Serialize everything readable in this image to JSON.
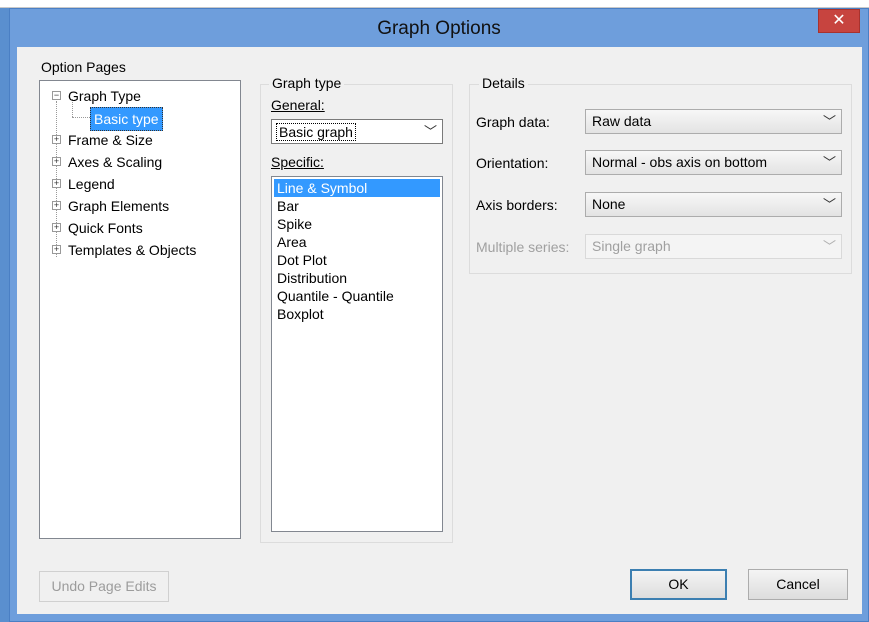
{
  "window": {
    "title": "Graph Options",
    "close_glyph": "✕"
  },
  "option_pages": {
    "label": "Option Pages",
    "items": [
      {
        "label": "Graph Type",
        "expander": "−"
      },
      {
        "label": "Basic type"
      },
      {
        "label": "Frame & Size",
        "expander": "+"
      },
      {
        "label": "Axes & Scaling",
        "expander": "+"
      },
      {
        "label": "Legend",
        "expander": "+"
      },
      {
        "label": "Graph Elements",
        "expander": "+"
      },
      {
        "label": "Quick Fonts",
        "expander": "+"
      },
      {
        "label": "Templates & Objects",
        "expander": "+"
      }
    ]
  },
  "graph_type": {
    "group_label": "Graph type",
    "general_label": "General:",
    "general_value": "Basic graph",
    "specific_label": "Specific:",
    "specific_items": [
      "Line & Symbol",
      "Bar",
      "Spike",
      "Area",
      "Dot Plot",
      "Distribution",
      "Quantile - Quantile",
      "Boxplot"
    ]
  },
  "details": {
    "group_label": "Details",
    "graph_data_label": "Graph data:",
    "graph_data_value": "Raw data",
    "orientation_label": "Orientation:",
    "orientation_value": "Normal - obs axis on bottom",
    "axis_borders_label": "Axis borders:",
    "axis_borders_value": "None",
    "multiple_series_label": "Multiple series:",
    "multiple_series_value": "Single graph"
  },
  "buttons": {
    "undo": "Undo Page Edits",
    "ok": "OK",
    "cancel": "Cancel"
  },
  "colors": {
    "title_bar": "#6e9edc",
    "selection": "#3399ff",
    "close": "#c7443f"
  }
}
